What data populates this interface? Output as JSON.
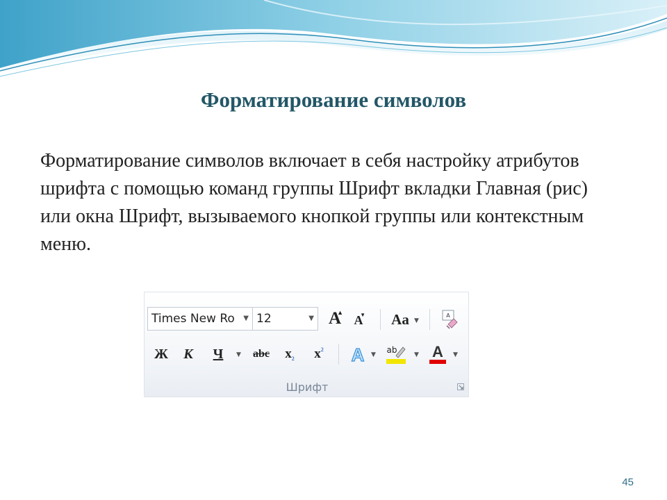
{
  "slide": {
    "title": "Форматирование символов",
    "body": "Форматирование символов включает в себя настройку атрибутов шрифта с помощью команд группы Шрифт вкладки Главная (рис) или окна Шрифт, вызываемого кнопкой группы или контекстным меню.",
    "page_number": "45"
  },
  "ribbon": {
    "font_name": "Times New Ro",
    "font_size": "12",
    "grow_font": "A",
    "shrink_font": "A",
    "change_case": "Aa",
    "clear_format": "A",
    "bold": "Ж",
    "italic": "К",
    "underline": "Ч",
    "strikethrough": "abc",
    "subscript": "x",
    "subscript_mark": "2",
    "superscript": "x",
    "superscript_mark": "2",
    "text_effects": "A",
    "highlight": "ab",
    "font_color": "A",
    "group_label": "Шрифт"
  },
  "colors": {
    "title": "#235767",
    "highlight": "#f2e600",
    "font_color_bar": "#e00000",
    "wave": "#5fb6d6"
  },
  "icons": [
    "text-effects-icon",
    "highlight-marker-icon",
    "clear-formatting-icon",
    "dialog-launcher-icon"
  ]
}
